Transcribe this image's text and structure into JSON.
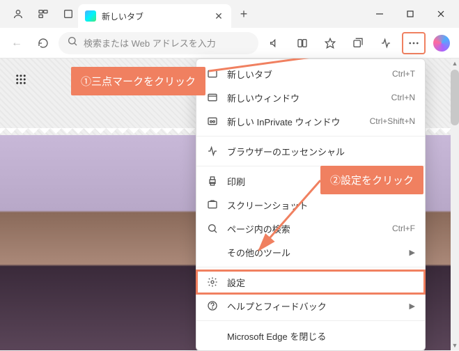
{
  "tab": {
    "title": "新しいタブ"
  },
  "addressbar": {
    "placeholder": "検索または Web アドレスを入力"
  },
  "callouts": {
    "step1": "①三点マークをクリック",
    "step2": "②設定をクリック"
  },
  "menu": {
    "new_tab": {
      "label": "新しいタブ",
      "shortcut": "Ctrl+T"
    },
    "new_window": {
      "label": "新しいウィンドウ",
      "shortcut": "Ctrl+N"
    },
    "new_inprivate": {
      "label": "新しい InPrivate ウィンドウ",
      "shortcut": "Ctrl+Shift+N"
    },
    "essentials": {
      "label": "ブラウザーのエッセンシャル"
    },
    "print": {
      "label": "印刷"
    },
    "screenshot": {
      "label": "スクリーンショット"
    },
    "find": {
      "label": "ページ内の検索",
      "shortcut": "Ctrl+F"
    },
    "more_tools": {
      "label": "その他のツール"
    },
    "settings": {
      "label": "設定"
    },
    "help": {
      "label": "ヘルプとフィードバック"
    },
    "close": {
      "label": "Microsoft Edge を閉じる"
    }
  }
}
